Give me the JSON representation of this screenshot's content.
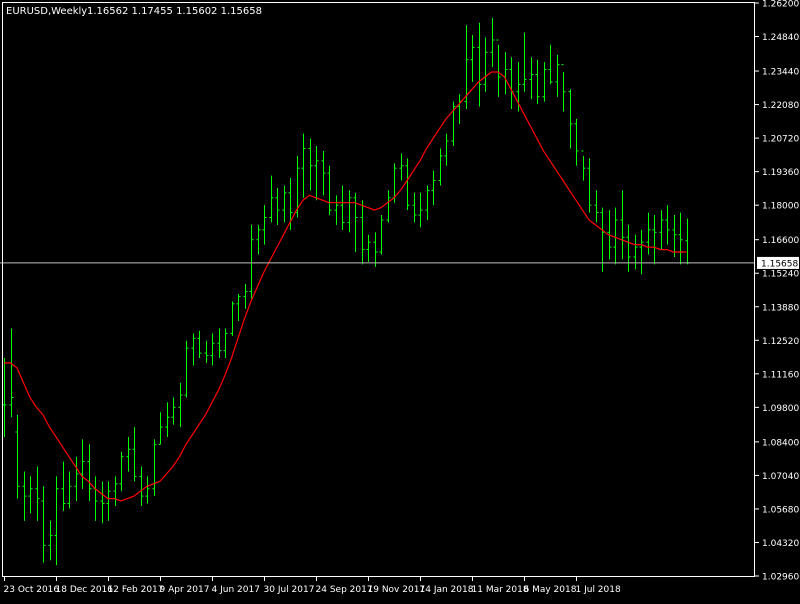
{
  "header": {
    "symbol_period": "EURUSD,Weekly",
    "ohlc": "1.16562 1.17455 1.15602 1.15658"
  },
  "colors": {
    "background": "#000000",
    "frame": "#ffffff",
    "bars": "#00ff00",
    "ma_line": "#ff0000",
    "bid_line": "#c0c0c0",
    "price_label_bg": "#ffffff",
    "price_label_text": "#000000"
  },
  "chart_data": {
    "type": "ohlc_bar",
    "title": "EURUSD,Weekly",
    "ylim": [
      1.0296,
      1.262
    ],
    "y_ticks": [
      "1.26200",
      "1.24840",
      "1.23440",
      "1.22080",
      "1.20720",
      "1.19360",
      "1.18000",
      "1.16600",
      "1.15240",
      "1.13880",
      "1.12520",
      "1.11160",
      "1.09800",
      "1.08400",
      "1.07040",
      "1.05680",
      "1.04320",
      "1.02960"
    ],
    "x_ticks": [
      "23 Oct 2016",
      "18 Dec 2016",
      "12 Feb 2017",
      "9 Apr 2017",
      "4 Jun 2017",
      "30 Jul 2017",
      "24 Sep 2017",
      "19 Nov 2017",
      "14 Jan 2018",
      "11 Mar 2018",
      "6 May 2018",
      "1 Jul 2018"
    ],
    "x_tick_bar_index": [
      0,
      8,
      16,
      24,
      32,
      40,
      48,
      56,
      64,
      72,
      80,
      88
    ],
    "current_price_label": "1.15658",
    "current_price": 1.15658,
    "bars": [
      [
        1.099,
        1.118,
        1.086,
        1.099
      ],
      [
        1.099,
        1.13,
        1.094,
        1.102
      ],
      [
        1.088,
        1.095,
        1.061,
        1.066
      ],
      [
        1.066,
        1.072,
        1.052,
        1.062
      ],
      [
        1.062,
        1.07,
        1.055,
        1.065
      ],
      [
        1.065,
        1.074,
        1.052,
        1.061
      ],
      [
        1.06,
        1.066,
        1.035,
        1.042
      ],
      [
        1.042,
        1.052,
        1.036,
        1.046
      ],
      [
        1.046,
        1.07,
        1.034,
        1.065
      ],
      [
        1.065,
        1.076,
        1.056,
        1.059
      ],
      [
        1.059,
        1.072,
        1.057,
        1.066
      ],
      [
        1.066,
        1.078,
        1.06,
        1.071
      ],
      [
        1.071,
        1.085,
        1.065,
        1.076
      ],
      [
        1.076,
        1.083,
        1.06,
        1.065
      ],
      [
        1.065,
        1.07,
        1.052,
        1.06
      ],
      [
        1.06,
        1.068,
        1.051,
        1.059
      ],
      [
        1.059,
        1.068,
        1.052,
        1.064
      ],
      [
        1.064,
        1.07,
        1.058,
        1.067
      ],
      [
        1.067,
        1.08,
        1.064,
        1.078
      ],
      [
        1.078,
        1.086,
        1.072,
        1.081
      ],
      [
        1.081,
        1.09,
        1.068,
        1.07
      ],
      [
        1.07,
        1.074,
        1.058,
        1.062
      ],
      [
        1.062,
        1.07,
        1.059,
        1.065
      ],
      [
        1.065,
        1.085,
        1.062,
        1.083
      ],
      [
        1.083,
        1.096,
        1.083,
        1.09
      ],
      [
        1.09,
        1.1,
        1.086,
        1.094
      ],
      [
        1.094,
        1.102,
        1.091,
        1.098
      ],
      [
        1.098,
        1.108,
        1.09,
        1.103
      ],
      [
        1.103,
        1.125,
        1.102,
        1.122
      ],
      [
        1.122,
        1.128,
        1.115,
        1.126
      ],
      [
        1.126,
        1.129,
        1.118,
        1.12
      ],
      [
        1.12,
        1.125,
        1.116,
        1.119
      ],
      [
        1.119,
        1.128,
        1.115,
        1.124
      ],
      [
        1.124,
        1.13,
        1.118,
        1.121
      ],
      [
        1.121,
        1.13,
        1.118,
        1.128
      ],
      [
        1.128,
        1.141,
        1.127,
        1.14
      ],
      [
        1.14,
        1.144,
        1.133,
        1.143
      ],
      [
        1.143,
        1.148,
        1.138,
        1.145
      ],
      [
        1.145,
        1.172,
        1.142,
        1.166
      ],
      [
        1.166,
        1.172,
        1.16,
        1.17
      ],
      [
        1.17,
        1.18,
        1.164,
        1.175
      ],
      [
        1.175,
        1.192,
        1.173,
        1.183
      ],
      [
        1.183,
        1.187,
        1.172,
        1.178
      ],
      [
        1.178,
        1.188,
        1.173,
        1.185
      ],
      [
        1.185,
        1.191,
        1.17,
        1.177
      ],
      [
        1.177,
        1.2,
        1.175,
        1.195
      ],
      [
        1.195,
        1.209,
        1.183,
        1.203
      ],
      [
        1.203,
        1.207,
        1.186,
        1.196
      ],
      [
        1.196,
        1.204,
        1.182,
        1.198
      ],
      [
        1.198,
        1.202,
        1.184,
        1.193
      ],
      [
        1.193,
        1.196,
        1.176,
        1.178
      ],
      [
        1.178,
        1.184,
        1.172,
        1.18
      ],
      [
        1.18,
        1.188,
        1.17,
        1.173
      ],
      [
        1.173,
        1.186,
        1.169,
        1.183
      ],
      [
        1.183,
        1.185,
        1.161,
        1.175
      ],
      [
        1.175,
        1.182,
        1.156,
        1.162
      ],
      [
        1.162,
        1.168,
        1.157,
        1.165
      ],
      [
        1.165,
        1.169,
        1.155,
        1.161
      ],
      [
        1.161,
        1.176,
        1.16,
        1.174
      ],
      [
        1.174,
        1.186,
        1.173,
        1.183
      ],
      [
        1.183,
        1.197,
        1.181,
        1.195
      ],
      [
        1.195,
        1.201,
        1.19,
        1.196
      ],
      [
        1.196,
        1.199,
        1.178,
        1.18
      ],
      [
        1.18,
        1.185,
        1.173,
        1.176
      ],
      [
        1.176,
        1.185,
        1.171,
        1.178
      ],
      [
        1.178,
        1.188,
        1.174,
        1.186
      ],
      [
        1.186,
        1.194,
        1.18,
        1.19
      ],
      [
        1.19,
        1.203,
        1.188,
        1.2
      ],
      [
        1.2,
        1.209,
        1.196,
        1.206
      ],
      [
        1.206,
        1.222,
        1.204,
        1.22
      ],
      [
        1.22,
        1.225,
        1.213,
        1.222
      ],
      [
        1.222,
        1.253,
        1.219,
        1.239
      ],
      [
        1.239,
        1.249,
        1.23,
        1.244
      ],
      [
        1.244,
        1.254,
        1.22,
        1.229
      ],
      [
        1.229,
        1.248,
        1.226,
        1.242
      ],
      [
        1.242,
        1.256,
        1.236,
        1.247
      ],
      [
        1.247,
        1.245,
        1.224,
        1.232
      ],
      [
        1.232,
        1.242,
        1.225,
        1.235
      ],
      [
        1.235,
        1.24,
        1.219,
        1.226
      ],
      [
        1.226,
        1.238,
        1.218,
        1.229
      ],
      [
        1.229,
        1.25,
        1.226,
        1.231
      ],
      [
        1.231,
        1.24,
        1.223,
        1.233
      ],
      [
        1.233,
        1.239,
        1.221,
        1.224
      ],
      [
        1.224,
        1.238,
        1.222,
        1.235
      ],
      [
        1.235,
        1.245,
        1.229,
        1.23
      ],
      [
        1.23,
        1.241,
        1.224,
        1.237
      ],
      [
        1.237,
        1.234,
        1.218,
        1.226
      ],
      [
        1.226,
        1.227,
        1.203,
        1.213
      ],
      [
        1.213,
        1.215,
        1.196,
        1.202
      ],
      [
        1.202,
        1.2,
        1.19,
        1.195
      ],
      [
        1.195,
        1.199,
        1.177,
        1.18
      ],
      [
        1.18,
        1.186,
        1.173,
        1.177
      ],
      [
        1.177,
        1.179,
        1.153,
        1.169
      ],
      [
        1.169,
        1.178,
        1.158,
        1.163
      ],
      [
        1.163,
        1.179,
        1.156,
        1.174
      ],
      [
        1.174,
        1.186,
        1.158,
        1.167
      ],
      [
        1.167,
        1.172,
        1.153,
        1.159
      ],
      [
        1.159,
        1.168,
        1.154,
        1.163
      ],
      [
        1.163,
        1.17,
        1.152,
        1.165
      ],
      [
        1.165,
        1.177,
        1.16,
        1.17
      ],
      [
        1.17,
        1.176,
        1.156,
        1.169
      ],
      [
        1.169,
        1.178,
        1.162,
        1.174
      ],
      [
        1.174,
        1.18,
        1.164,
        1.17
      ],
      [
        1.17,
        1.176,
        1.159,
        1.168
      ],
      [
        1.168,
        1.177,
        1.156,
        1.166
      ],
      [
        1.16562,
        1.17455,
        1.15602,
        1.15658
      ]
    ],
    "ma": [
      1.116,
      1.116,
      1.114,
      1.108,
      1.102,
      1.098,
      1.095,
      1.09,
      1.086,
      1.082,
      1.078,
      1.074,
      1.07,
      1.068,
      1.065,
      1.063,
      1.061,
      1.061,
      1.06,
      1.061,
      1.062,
      1.064,
      1.066,
      1.067,
      1.068,
      1.071,
      1.074,
      1.078,
      1.083,
      1.087,
      1.091,
      1.095,
      1.1,
      1.105,
      1.111,
      1.118,
      1.126,
      1.134,
      1.141,
      1.147,
      1.153,
      1.158,
      1.163,
      1.168,
      1.173,
      1.178,
      1.182,
      1.184,
      1.183,
      1.182,
      1.181,
      1.181,
      1.181,
      1.181,
      1.181,
      1.18,
      1.179,
      1.178,
      1.179,
      1.181,
      1.183,
      1.186,
      1.19,
      1.194,
      1.198,
      1.203,
      1.207,
      1.211,
      1.215,
      1.218,
      1.221,
      1.224,
      1.227,
      1.23,
      1.232,
      1.234,
      1.234,
      1.232,
      1.227,
      1.222,
      1.217,
      1.212,
      1.207,
      1.202,
      1.198,
      1.194,
      1.19,
      1.186,
      1.182,
      1.178,
      1.174,
      1.172,
      1.17,
      1.168,
      1.167,
      1.166,
      1.165,
      1.164,
      1.164,
      1.163,
      1.163,
      1.162,
      1.162,
      1.161,
      1.161,
      1.161
    ]
  }
}
